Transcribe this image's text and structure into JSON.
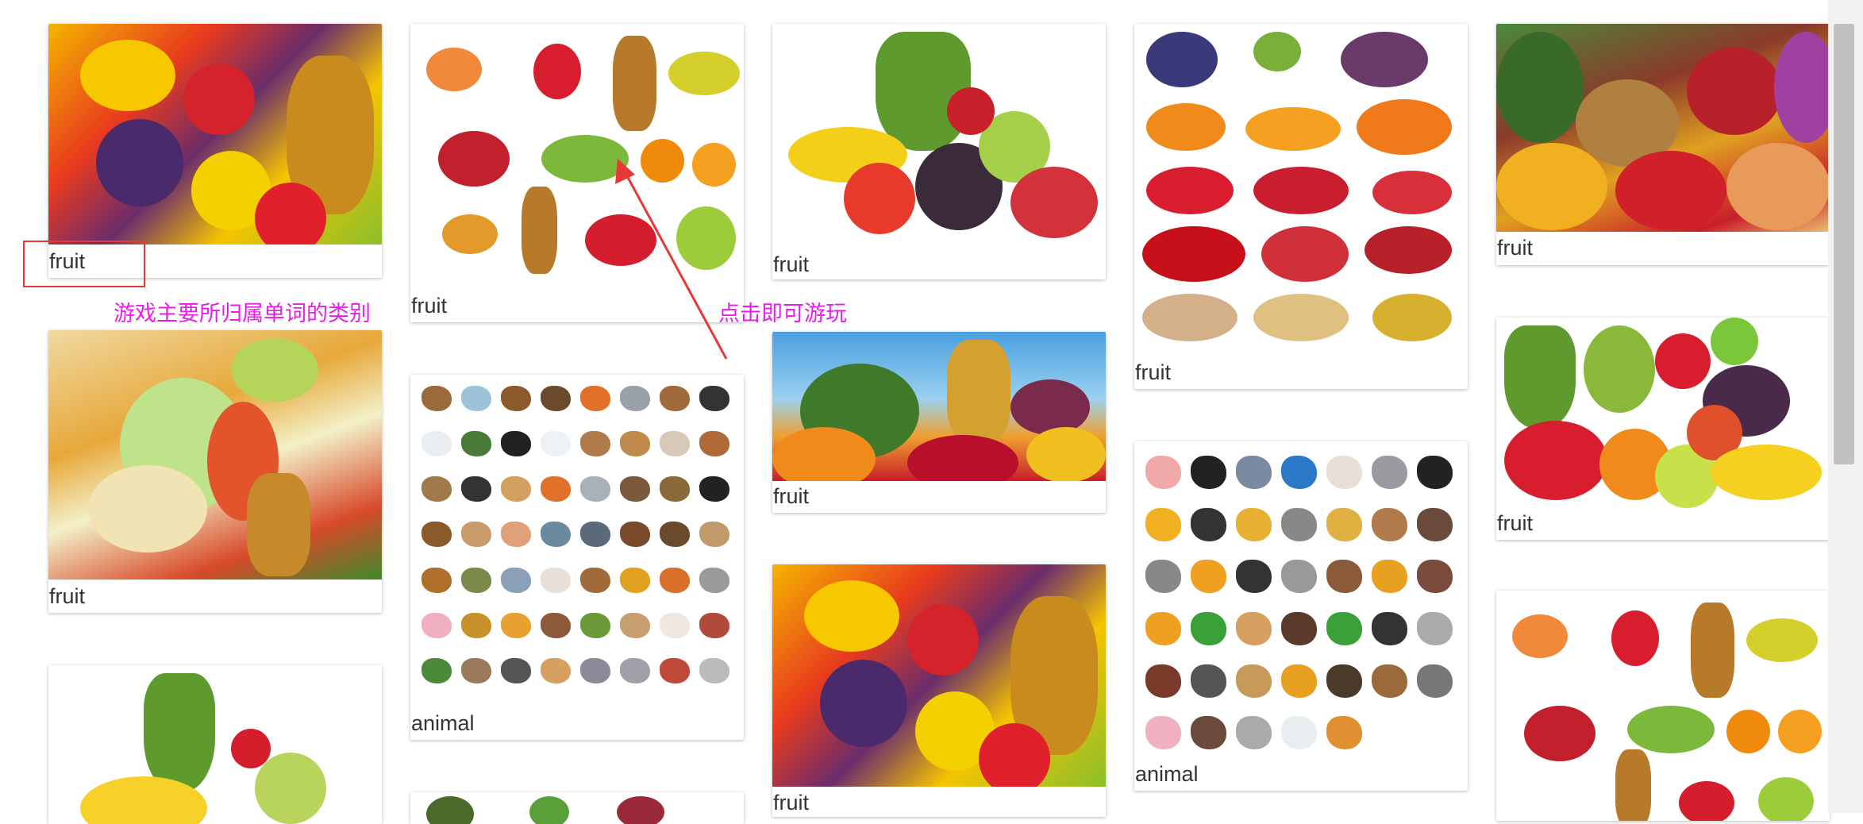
{
  "cards": [
    {
      "caption": "fruit"
    },
    {
      "caption": "fruit"
    },
    {
      "caption": "fruit"
    },
    {
      "caption": "fruit"
    },
    {
      "caption": "fruit"
    },
    {
      "caption": "animal"
    },
    {
      "caption": "fruit"
    },
    {
      "caption": "fruit"
    },
    {
      "caption": "fruit"
    },
    {
      "caption": "fruit"
    },
    {
      "caption": "animal"
    },
    {
      "caption": "fruit"
    }
  ],
  "annotations": {
    "category_label": "游戏主要所归属单词的类别",
    "click_hint": "点击即可游玩"
  },
  "colors": {
    "annotation": "#e81ee8",
    "highlight_box": "#e53935"
  }
}
